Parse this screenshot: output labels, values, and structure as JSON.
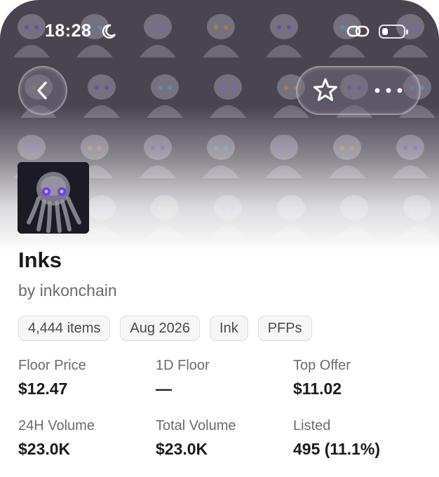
{
  "status_bar": {
    "time": "18:28",
    "icons": [
      "moon-icon",
      "link-icon",
      "battery-icon"
    ],
    "battery_level": 0.3
  },
  "nav": {
    "back_icon": "chevron-left-icon",
    "favorite_icon": "star-icon",
    "more_icon": "ellipsis-icon"
  },
  "collection": {
    "name": "Inks",
    "creator": "by inkonchain",
    "chips": [
      "4,444 items",
      "Aug 2026",
      "Ink",
      "PFPs"
    ]
  },
  "stats": [
    {
      "label": "Floor Price",
      "value": "$12.47"
    },
    {
      "label": "1D Floor",
      "value": "—"
    },
    {
      "label": "Top Offer",
      "value": "$11.02"
    },
    {
      "label": "24H Volume",
      "value": "$23.0K"
    },
    {
      "label": "Total Volume",
      "value": "$23.0K"
    },
    {
      "label": "Listed",
      "value": "495 (11.1%)"
    }
  ],
  "colors": {
    "accent": "#7b5cff",
    "text_primary": "#1a1a1a",
    "text_secondary": "#6b6b6b",
    "chip_background": "#f6f6f6",
    "banner": "#4a4450"
  }
}
